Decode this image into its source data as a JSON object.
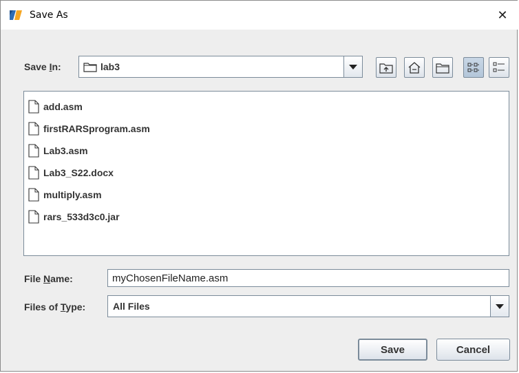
{
  "window": {
    "title": "Save As",
    "close_glyph": "✕"
  },
  "save_in": {
    "label_prefix": "Save ",
    "label_mnemonic": "I",
    "label_suffix": "n:",
    "value": "lab3",
    "toolbar": [
      "up-one-level-icon",
      "home-icon",
      "new-folder-icon",
      "list-view-icon",
      "details-view-icon"
    ]
  },
  "files": [
    {
      "name": "add.asm"
    },
    {
      "name": "firstRARSprogram.asm"
    },
    {
      "name": "Lab3.asm"
    },
    {
      "name": "Lab3_S22.docx"
    },
    {
      "name": "multiply.asm"
    },
    {
      "name": "rars_533d3c0.jar"
    }
  ],
  "file_name": {
    "label_prefix": "File ",
    "label_mnemonic": "N",
    "label_suffix": "ame:",
    "value": "myChosenFileName.asm"
  },
  "file_type": {
    "label_prefix": "Files of ",
    "label_mnemonic": "T",
    "label_suffix": "ype:",
    "value": "All Files"
  },
  "buttons": {
    "save": "Save",
    "cancel": "Cancel"
  },
  "colors": {
    "border": "#7a8a99",
    "dialog_bg": "#eeeeee",
    "icon_blue": "#2f6db5",
    "icon_orange": "#f5a623"
  }
}
